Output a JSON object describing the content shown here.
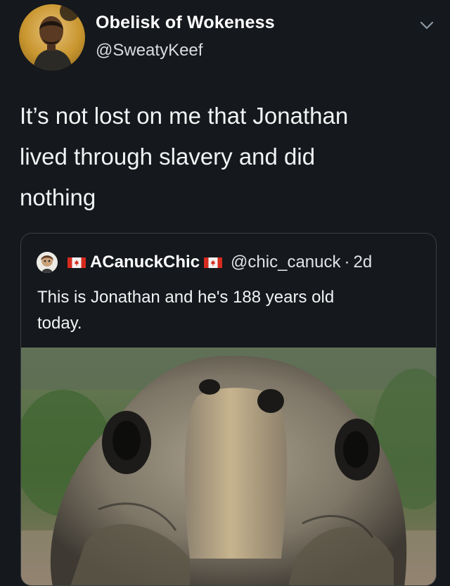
{
  "tweet": {
    "display_name": "Obelisk of Wokeness",
    "handle": "@SweatyKeef",
    "text": "It’s not lost on me that Jonathan\nlived through slavery and did\nnothing",
    "menu_icon": "chevron-down-icon"
  },
  "quoted_tweet": {
    "display_name": "ACanuckChic",
    "handle": "@chic_canuck",
    "separator": "·",
    "age": "2d",
    "text": "This is Jonathan and he's 188 years old\ntoday.",
    "flag_icon": "canada-flag-icon",
    "image": "tortoise-head-closeup"
  },
  "colors": {
    "background": "#15181c",
    "text": "#e7e9ea",
    "card_border": "#3a3f45"
  }
}
